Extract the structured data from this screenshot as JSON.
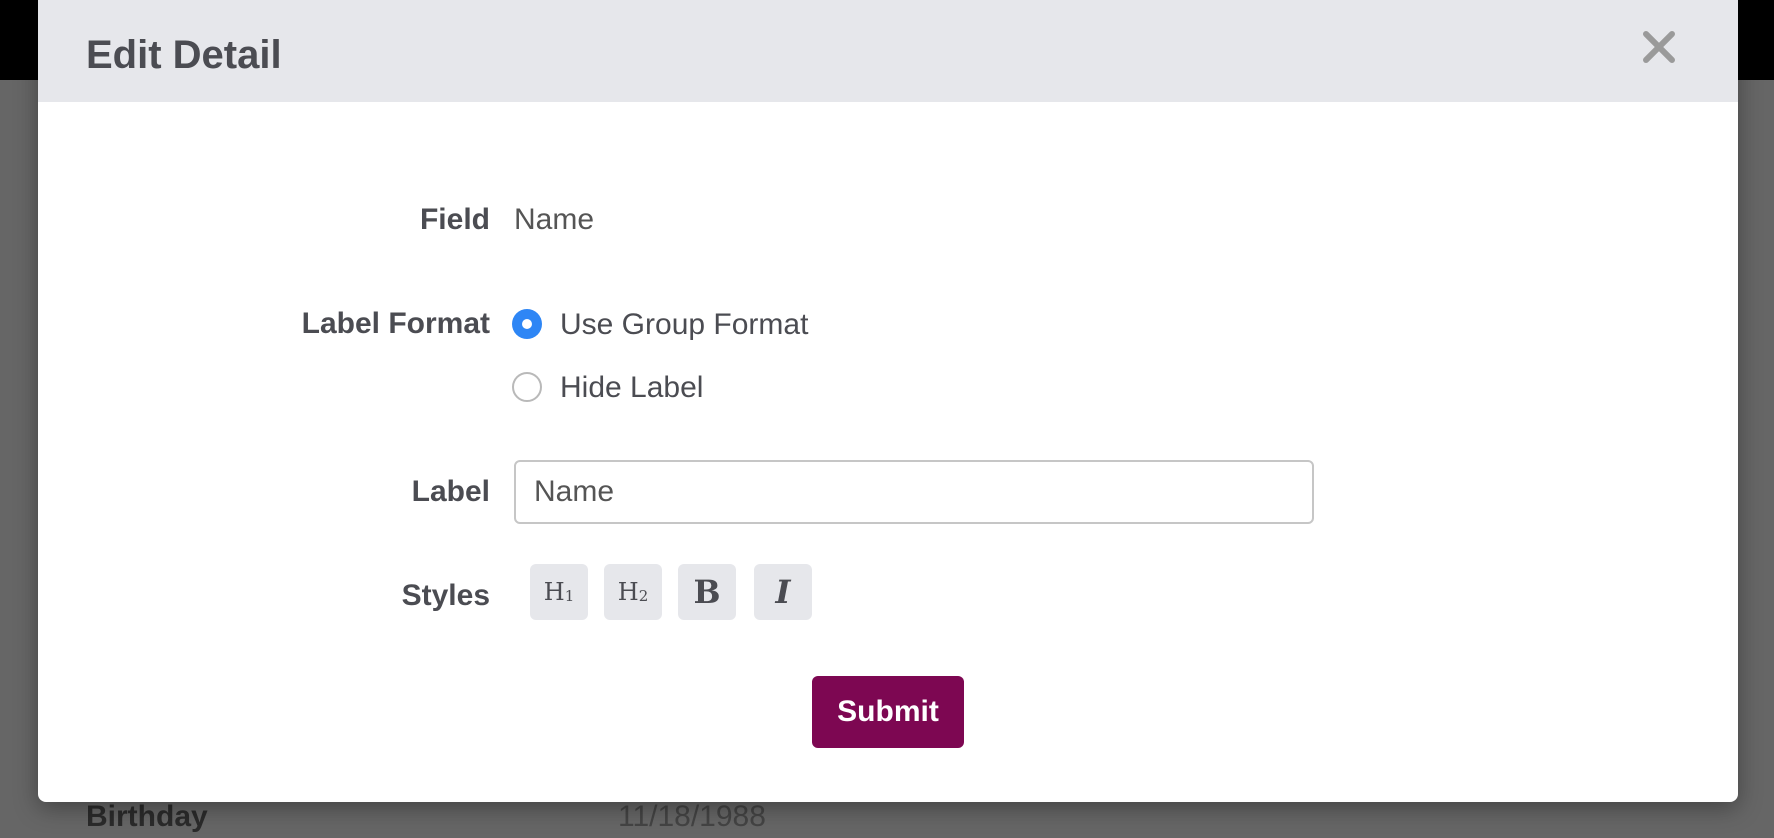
{
  "background": {
    "row_label": "Birthday",
    "row_value": "11/18/1988"
  },
  "modal": {
    "title": "Edit Detail",
    "close_icon": "close-icon",
    "field": {
      "label": "Field",
      "value": "Name"
    },
    "label_format": {
      "label": "Label Format",
      "options": [
        {
          "label": "Use Group Format",
          "checked": true
        },
        {
          "label": "Hide Label",
          "checked": false
        }
      ]
    },
    "label_field": {
      "label": "Label",
      "value": "Name"
    },
    "styles": {
      "label": "Styles",
      "buttons": [
        {
          "main": "H",
          "sub": "1"
        },
        {
          "main": "H",
          "sub": "2"
        },
        {
          "main": "B"
        },
        {
          "main": "I"
        }
      ]
    },
    "submit_label": "Submit"
  },
  "colors": {
    "accent": "#2e86f5",
    "submit": "#7d0752",
    "header_bg": "#e6e7eb"
  }
}
